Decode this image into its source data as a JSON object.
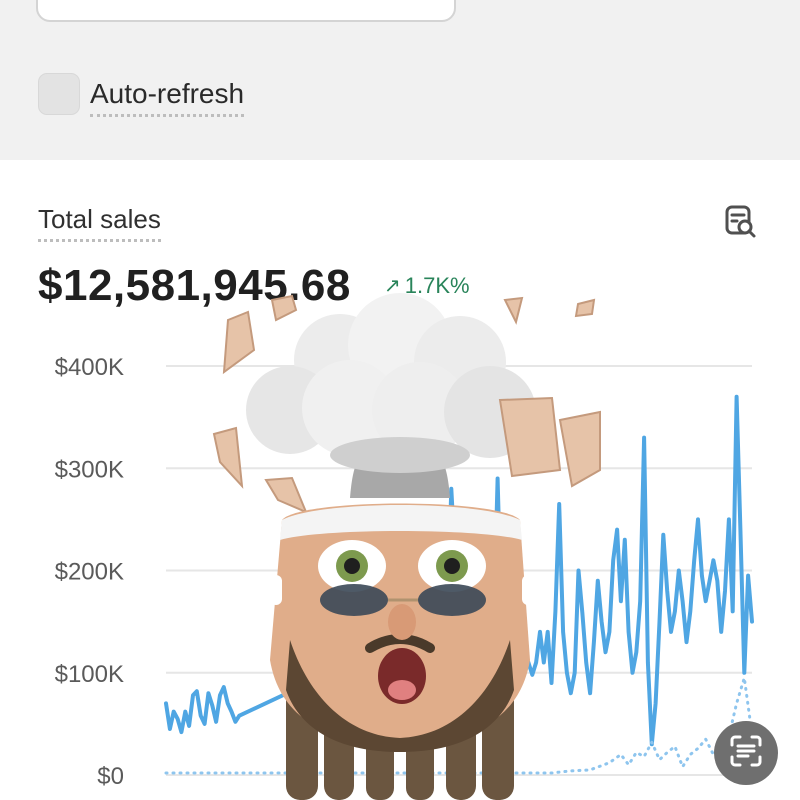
{
  "top": {
    "auto_refresh": {
      "label": "Auto-refresh",
      "checked": false
    }
  },
  "card": {
    "title": "Total sales",
    "total_value": "$12,581,945.68",
    "trend": {
      "direction": "up",
      "text": "1.7K%",
      "color": "#29845a"
    },
    "icons": {
      "explain": "search-document-icon",
      "scan": "scan-text-icon"
    }
  },
  "chart_data": {
    "type": "line",
    "yticks": [
      "$400K",
      "$300K",
      "$200K",
      "$100K",
      "$0"
    ],
    "ylim": [
      0,
      400000
    ],
    "grid": true,
    "series": [
      {
        "color": "#4fa6e3",
        "style": "solid",
        "points": [
          [
            0,
            70000
          ],
          [
            1,
            45000
          ],
          [
            2,
            62000
          ],
          [
            3,
            55000
          ],
          [
            4,
            42000
          ],
          [
            5,
            62000
          ],
          [
            6,
            48000
          ],
          [
            7,
            78000
          ],
          [
            8,
            82000
          ],
          [
            9,
            58000
          ],
          [
            10,
            50000
          ],
          [
            11,
            80000
          ],
          [
            12,
            68000
          ],
          [
            13,
            52000
          ],
          [
            14,
            78000
          ],
          [
            15,
            86000
          ],
          [
            16,
            70000
          ],
          [
            17,
            62000
          ],
          [
            18,
            52000
          ],
          [
            19,
            58000
          ],
          [
            71,
            150000
          ],
          [
            72,
            130000
          ],
          [
            73,
            155000
          ],
          [
            74,
            280000
          ],
          [
            75,
            210000
          ],
          [
            76,
            170000
          ],
          [
            77,
            160000
          ],
          [
            78,
            140000
          ],
          [
            79,
            160000
          ],
          [
            80,
            150000
          ],
          [
            81,
            175000
          ],
          [
            82,
            180000
          ],
          [
            83,
            205000
          ],
          [
            84,
            165000
          ],
          [
            85,
            145000
          ],
          [
            86,
            290000
          ],
          [
            87,
            150000
          ],
          [
            88,
            115000
          ],
          [
            89,
            90000
          ],
          [
            90,
            80000
          ],
          [
            91,
            120000
          ],
          [
            92,
            145000
          ],
          [
            93,
            120000
          ],
          [
            94,
            110000
          ],
          [
            95,
            98000
          ],
          [
            96,
            110000
          ],
          [
            97,
            140000
          ],
          [
            98,
            110000
          ],
          [
            99,
            140000
          ],
          [
            100,
            90000
          ],
          [
            101,
            160000
          ],
          [
            102,
            265000
          ],
          [
            103,
            140000
          ],
          [
            104,
            100000
          ],
          [
            105,
            80000
          ],
          [
            106,
            100000
          ],
          [
            107,
            200000
          ],
          [
            108,
            158000
          ],
          [
            109,
            110000
          ],
          [
            110,
            80000
          ],
          [
            111,
            130000
          ],
          [
            112,
            190000
          ],
          [
            113,
            150000
          ],
          [
            114,
            120000
          ],
          [
            115,
            140000
          ],
          [
            116,
            210000
          ],
          [
            117,
            240000
          ],
          [
            118,
            170000
          ],
          [
            119,
            230000
          ],
          [
            120,
            140000
          ],
          [
            121,
            100000
          ],
          [
            122,
            120000
          ],
          [
            123,
            170000
          ],
          [
            124,
            330000
          ],
          [
            125,
            110000
          ],
          [
            126,
            30000
          ],
          [
            127,
            70000
          ],
          [
            128,
            150000
          ],
          [
            129,
            235000
          ],
          [
            130,
            180000
          ],
          [
            131,
            140000
          ],
          [
            132,
            160000
          ],
          [
            133,
            200000
          ],
          [
            134,
            170000
          ],
          [
            135,
            130000
          ],
          [
            136,
            160000
          ],
          [
            137,
            210000
          ],
          [
            138,
            250000
          ],
          [
            139,
            195000
          ],
          [
            140,
            170000
          ],
          [
            141,
            190000
          ],
          [
            142,
            210000
          ],
          [
            143,
            190000
          ],
          [
            144,
            140000
          ],
          [
            145,
            180000
          ],
          [
            146,
            250000
          ],
          [
            147,
            160000
          ],
          [
            148,
            370000
          ],
          [
            149,
            240000
          ],
          [
            150,
            100000
          ],
          [
            151,
            195000
          ],
          [
            152,
            150000
          ]
        ]
      },
      {
        "color": "#8ec5ee",
        "style": "dotted",
        "points": [
          [
            0,
            2000
          ],
          [
            20,
            2000
          ],
          [
            40,
            2000
          ],
          [
            60,
            2000
          ],
          [
            80,
            2000
          ],
          [
            100,
            2000
          ],
          [
            105,
            4000
          ],
          [
            110,
            5000
          ],
          [
            115,
            12000
          ],
          [
            118,
            20000
          ],
          [
            120,
            10000
          ],
          [
            122,
            22000
          ],
          [
            124,
            18000
          ],
          [
            126,
            32000
          ],
          [
            128,
            15000
          ],
          [
            130,
            22000
          ],
          [
            132,
            28000
          ],
          [
            134,
            8000
          ],
          [
            136,
            20000
          ],
          [
            138,
            26000
          ],
          [
            140,
            35000
          ],
          [
            142,
            20000
          ],
          [
            144,
            30000
          ],
          [
            146,
            38000
          ],
          [
            148,
            70000
          ],
          [
            150,
            95000
          ],
          [
            152,
            40000
          ]
        ]
      }
    ]
  }
}
